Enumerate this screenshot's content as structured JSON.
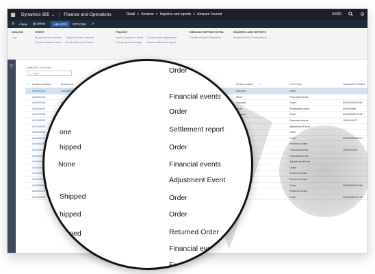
{
  "topbar": {
    "app_name": "Dynamics 365",
    "app_chevron": "⌄",
    "module": "Finance and Operations",
    "breadcrumbs": [
      "Retail",
      ">",
      "Amazon",
      ">",
      "Inquiries and reports",
      ">",
      "Amazon Journal"
    ],
    "company": "USRR",
    "icons": [
      "waffle-icon",
      "search-icon",
      "settings-icon"
    ]
  },
  "actionbar": {
    "new": "+ New",
    "delete": "Delete",
    "tab_active": "AMAZON",
    "tab_options": "OPTIONS",
    "search_glyph": "⌕"
  },
  "ribbon": {
    "groups": [
      {
        "title": "AMAZON",
        "items": [
          "Log"
        ]
      },
      {
        "title": "ORDER",
        "items": [
          "Import Amazon orders",
          "Import Amazon returns",
          "Create Amazon order",
          "Create Returned Order"
        ]
      },
      {
        "title": "FINANCE",
        "items": [
          "Import financial events",
          "Create stock adjustment",
          "Create general ledger",
          "Create settlement report"
        ]
      },
      {
        "title": "INBOUND SHIPMENTS FBA",
        "items": [
          "Create Inbound Shipment"
        ]
      },
      {
        "title": "INQUIRIES AND REPORTS",
        "items": [
          "Amazon Feed Transactions"
        ]
      }
    ]
  },
  "page": {
    "title": "AMAZON JOURNAL",
    "filter_placeholder": "Filter",
    "filter_icon": "⌕",
    "sidebar_icon": "▽"
  },
  "grid": {
    "headers": [
      "✓",
      "Amazon transac...",
      "Amazon Id",
      "Date ↓",
      "Order status",
      "Amazon status",
      "Feed Type",
      "Transaction relation"
    ],
    "header_filter_glyph": "▽",
    "rows": [
      {
        "id": "A00000412",
        "amazon_id": "112-3575335-2823409",
        "amazon_status": "Shipped",
        "feed": "Order",
        "rel": ""
      },
      {
        "id": "A00000446",
        "amazon_id": "",
        "amazon_status": "None",
        "feed": "Financial events",
        "rel": ""
      },
      {
        "id": "A00000963",
        "amazon_id": "111-4411456",
        "amazon_status": "Shipped",
        "feed": "Order",
        "rel": "SO00000007350"
      },
      {
        "id": "A00005531",
        "amazon_id": "65240795",
        "amazon_status": "None",
        "feed": "Settlement report",
        "rel": "000004966"
      },
      {
        "id": "A00007836",
        "amazon_id": "114-9028",
        "amazon_status": "Shipped",
        "feed": "Order",
        "rel": "SO00000007442"
      },
      {
        "id": "A00005532",
        "amazon_id": "",
        "amazon_status": "",
        "feed": "Financial events",
        "rel": "J000010427"
      },
      {
        "id": "A00005523",
        "amazon_id": "",
        "amazon_status": "",
        "feed": "Adjustment Event",
        "rel": ""
      },
      {
        "id": "A00006506",
        "amazon_id": "",
        "amazon_status": "",
        "feed": "Order",
        "rel": ""
      },
      {
        "id": "A00006145",
        "amazon_id": "",
        "amazon_status": "",
        "feed": "Order",
        "rel": "SO00000005874"
      },
      {
        "id": "A00006350",
        "amazon_id": "",
        "amazon_status": "",
        "feed": "Returned Order",
        "rel": ""
      },
      {
        "id": "A00005496",
        "amazon_id": "",
        "amazon_status": "",
        "feed": "Financial events",
        "rel": "J000010426"
      },
      {
        "id": "A00005501",
        "amazon_id": "",
        "amazon_status": "",
        "feed": "Financial events",
        "rel": ""
      },
      {
        "id": "A00005497",
        "amazon_id": "",
        "amazon_status": "",
        "feed": "Adjustment Event",
        "rel": ""
      },
      {
        "id": "A00005234",
        "amazon_id": "",
        "amazon_status": "",
        "feed": "Order",
        "rel": ""
      },
      {
        "id": "A00005401",
        "amazon_id": "",
        "amazon_status": "",
        "feed": "Returned Order",
        "rel": ""
      },
      {
        "id": "A00005403",
        "amazon_id": "",
        "amazon_status": "",
        "feed": "Returned Order",
        "rel": ""
      },
      {
        "id": "A00005054",
        "amazon_id": "",
        "amazon_status": "Shipped",
        "feed": "Order",
        "rel": "SO00000004786"
      },
      {
        "id": "A00005405",
        "amazon_id": "113",
        "amazon_status": "Returned",
        "feed": "Returned Order",
        "rel": ""
      },
      {
        "id": "A00005809",
        "amazon_id": "202-2",
        "amazon_status": "Shipped",
        "feed": "Order",
        "rel": "SO00000010176"
      }
    ]
  },
  "magnifier": {
    "feed_types": [
      "Order",
      "Financial events",
      "Order",
      "Settlement report",
      "Order",
      "Financial events",
      "Adjustment Event",
      "Order",
      "Order",
      "Returned Order",
      "Financial events",
      "Financial events",
      "Adjustment"
    ],
    "statuses": [
      "one",
      "hipped",
      "None",
      "Shipped",
      "hipped",
      "turned"
    ]
  }
}
